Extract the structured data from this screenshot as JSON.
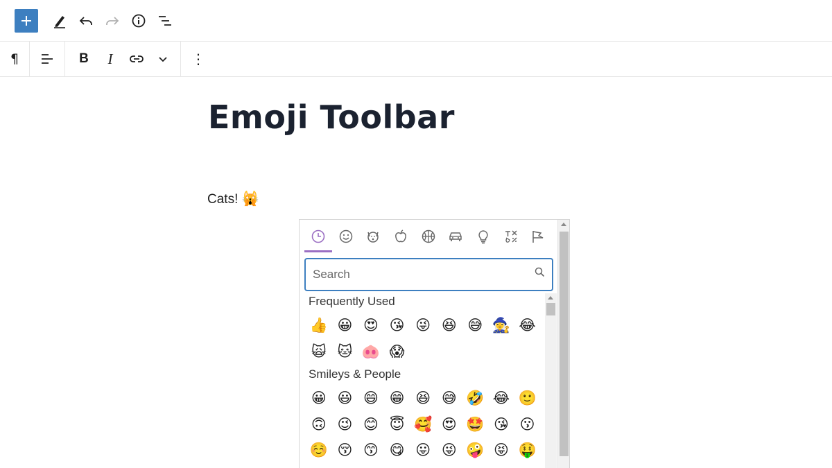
{
  "header": {
    "add_button_label": "+",
    "icons": [
      "plus-icon",
      "pencil-icon",
      "undo-icon",
      "redo-icon",
      "info-icon",
      "list-view-icon"
    ]
  },
  "block_toolbar": {
    "paragraph_symbol": "¶",
    "bold_label": "B",
    "italic_label": "I",
    "more_symbol": "⋮"
  },
  "content": {
    "title": "Emoji Toolbar",
    "paragraph_text": "Cats!",
    "paragraph_emoji": "🙀"
  },
  "emoji_picker": {
    "categories": [
      "recent",
      "smileys",
      "animals",
      "food",
      "activity",
      "travel",
      "objects",
      "symbols",
      "flags"
    ],
    "active_category": "recent",
    "accent_color": "#9b6fc3",
    "search": {
      "placeholder": "Search",
      "value": ""
    },
    "sections": [
      {
        "label": "Frequently Used",
        "rows": [
          [
            "👍",
            "😀",
            "😍",
            "😘",
            "😜",
            "😆",
            "😅",
            "🧙‍♀️",
            "😂"
          ],
          [
            "🙀",
            "🐱",
            "🐽",
            "😱"
          ]
        ]
      },
      {
        "label": "Smileys & People",
        "rows": [
          [
            "😀",
            "😃",
            "😄",
            "😁",
            "😆",
            "😅",
            "🤣",
            "😂",
            "🙂"
          ],
          [
            "🙃",
            "😉",
            "😊",
            "😇",
            "🥰",
            "😍",
            "🤩",
            "😘",
            "😗"
          ],
          [
            "☺️",
            "😚",
            "😙",
            "😋",
            "😛",
            "😜",
            "🤪",
            "😝",
            "🤑"
          ]
        ]
      }
    ]
  },
  "colors": {
    "primary_blue": "#3d7fc0",
    "text_dark": "#1e1e1e",
    "title_color": "#1b2230"
  }
}
